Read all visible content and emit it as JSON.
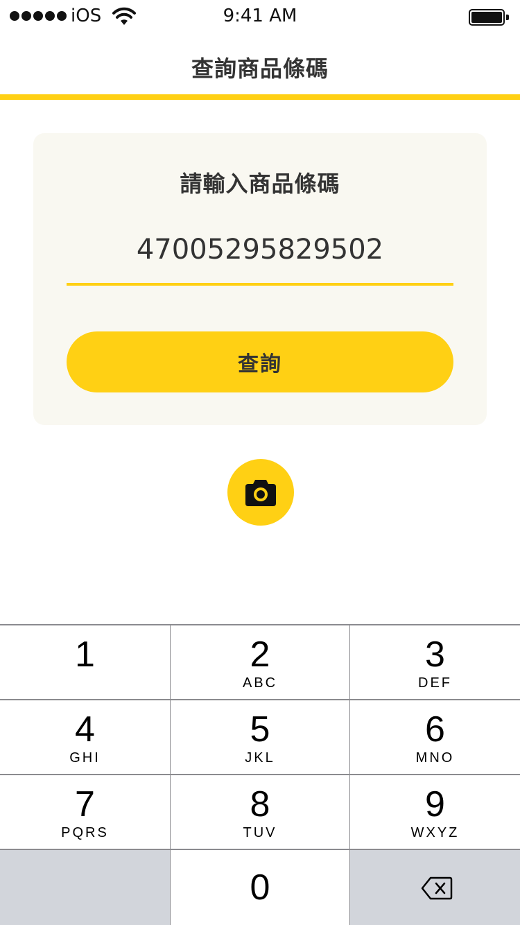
{
  "status_bar": {
    "carrier": "iOS",
    "time": "9:41 AM"
  },
  "nav": {
    "title": "查詢商品條碼"
  },
  "form": {
    "prompt": "請輸入商品條碼",
    "barcode_value": "47005295829502",
    "query_label": "查詢"
  },
  "icons": {
    "camera": "camera-icon",
    "backspace": "backspace-icon",
    "wifi": "wifi-icon",
    "battery": "battery-icon"
  },
  "colors": {
    "accent": "#ffd014",
    "card_bg": "#f9f8f1",
    "text": "#333333"
  },
  "keypad": {
    "keys": [
      {
        "digit": "1",
        "letters": ""
      },
      {
        "digit": "2",
        "letters": "ABC"
      },
      {
        "digit": "3",
        "letters": "DEF"
      },
      {
        "digit": "4",
        "letters": "GHI"
      },
      {
        "digit": "5",
        "letters": "JKL"
      },
      {
        "digit": "6",
        "letters": "MNO"
      },
      {
        "digit": "7",
        "letters": "PQRS"
      },
      {
        "digit": "8",
        "letters": "TUV"
      },
      {
        "digit": "9",
        "letters": "WXYZ"
      },
      {
        "digit": "0",
        "letters": ""
      }
    ]
  }
}
